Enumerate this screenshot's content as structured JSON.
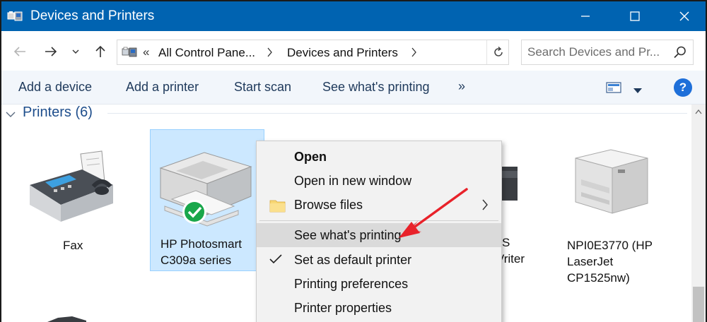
{
  "window": {
    "title": "Devices and Printers",
    "icons": {
      "app": "devices-printers-icon",
      "minimize": "minimize-icon",
      "maximize": "maximize-icon",
      "close": "close-icon"
    }
  },
  "nav": {
    "breadcrumb_prefix": "«",
    "crumbs": [
      "All Control Pane...",
      "Devices and Printers"
    ],
    "search_placeholder": "Search Devices and Pr...",
    "icons": {
      "back": "arrow-left-icon",
      "forward": "arrow-right-icon",
      "recent": "chevron-down-icon",
      "up": "arrow-up-icon",
      "refresh": "refresh-icon",
      "search": "search-icon"
    }
  },
  "commands": {
    "add_device": "Add a device",
    "add_printer": "Add a printer",
    "start_scan": "Start scan",
    "see_printing": "See what's printing",
    "more": "»",
    "help": "?"
  },
  "group": {
    "label": "Printers (6)"
  },
  "devices": [
    {
      "name": "Fax",
      "icon": "fax-icon"
    },
    {
      "name_line1": "HP Photosmart",
      "name_line2": "C309a series",
      "icon": "inkjet-printer-icon",
      "default": true
    },
    {
      "name_line1": "S",
      "name_line2": "Vriter",
      "icon": "printer-icon"
    },
    {
      "name_line1": "NPI0E3770 (HP",
      "name_line2": "LaserJet",
      "name_line3": "CP1525nw)",
      "icon": "laser-printer-icon"
    }
  ],
  "context_menu": {
    "items": [
      {
        "label": "Open",
        "bold": true
      },
      {
        "label": "Open in new window"
      },
      {
        "label": "Browse files",
        "icon": "folder-icon",
        "submenu": true
      },
      {
        "label": "See what's printing",
        "hover": true
      },
      {
        "label": "Set as default printer",
        "icon": "checkmark-icon"
      },
      {
        "label": "Printing preferences"
      },
      {
        "label": "Printer properties"
      }
    ]
  },
  "colors": {
    "titlebar": "#0063b1",
    "selection": "#cce8ff",
    "annotation_arrow": "#e8222a",
    "link_blue": "#1e4e8c"
  }
}
